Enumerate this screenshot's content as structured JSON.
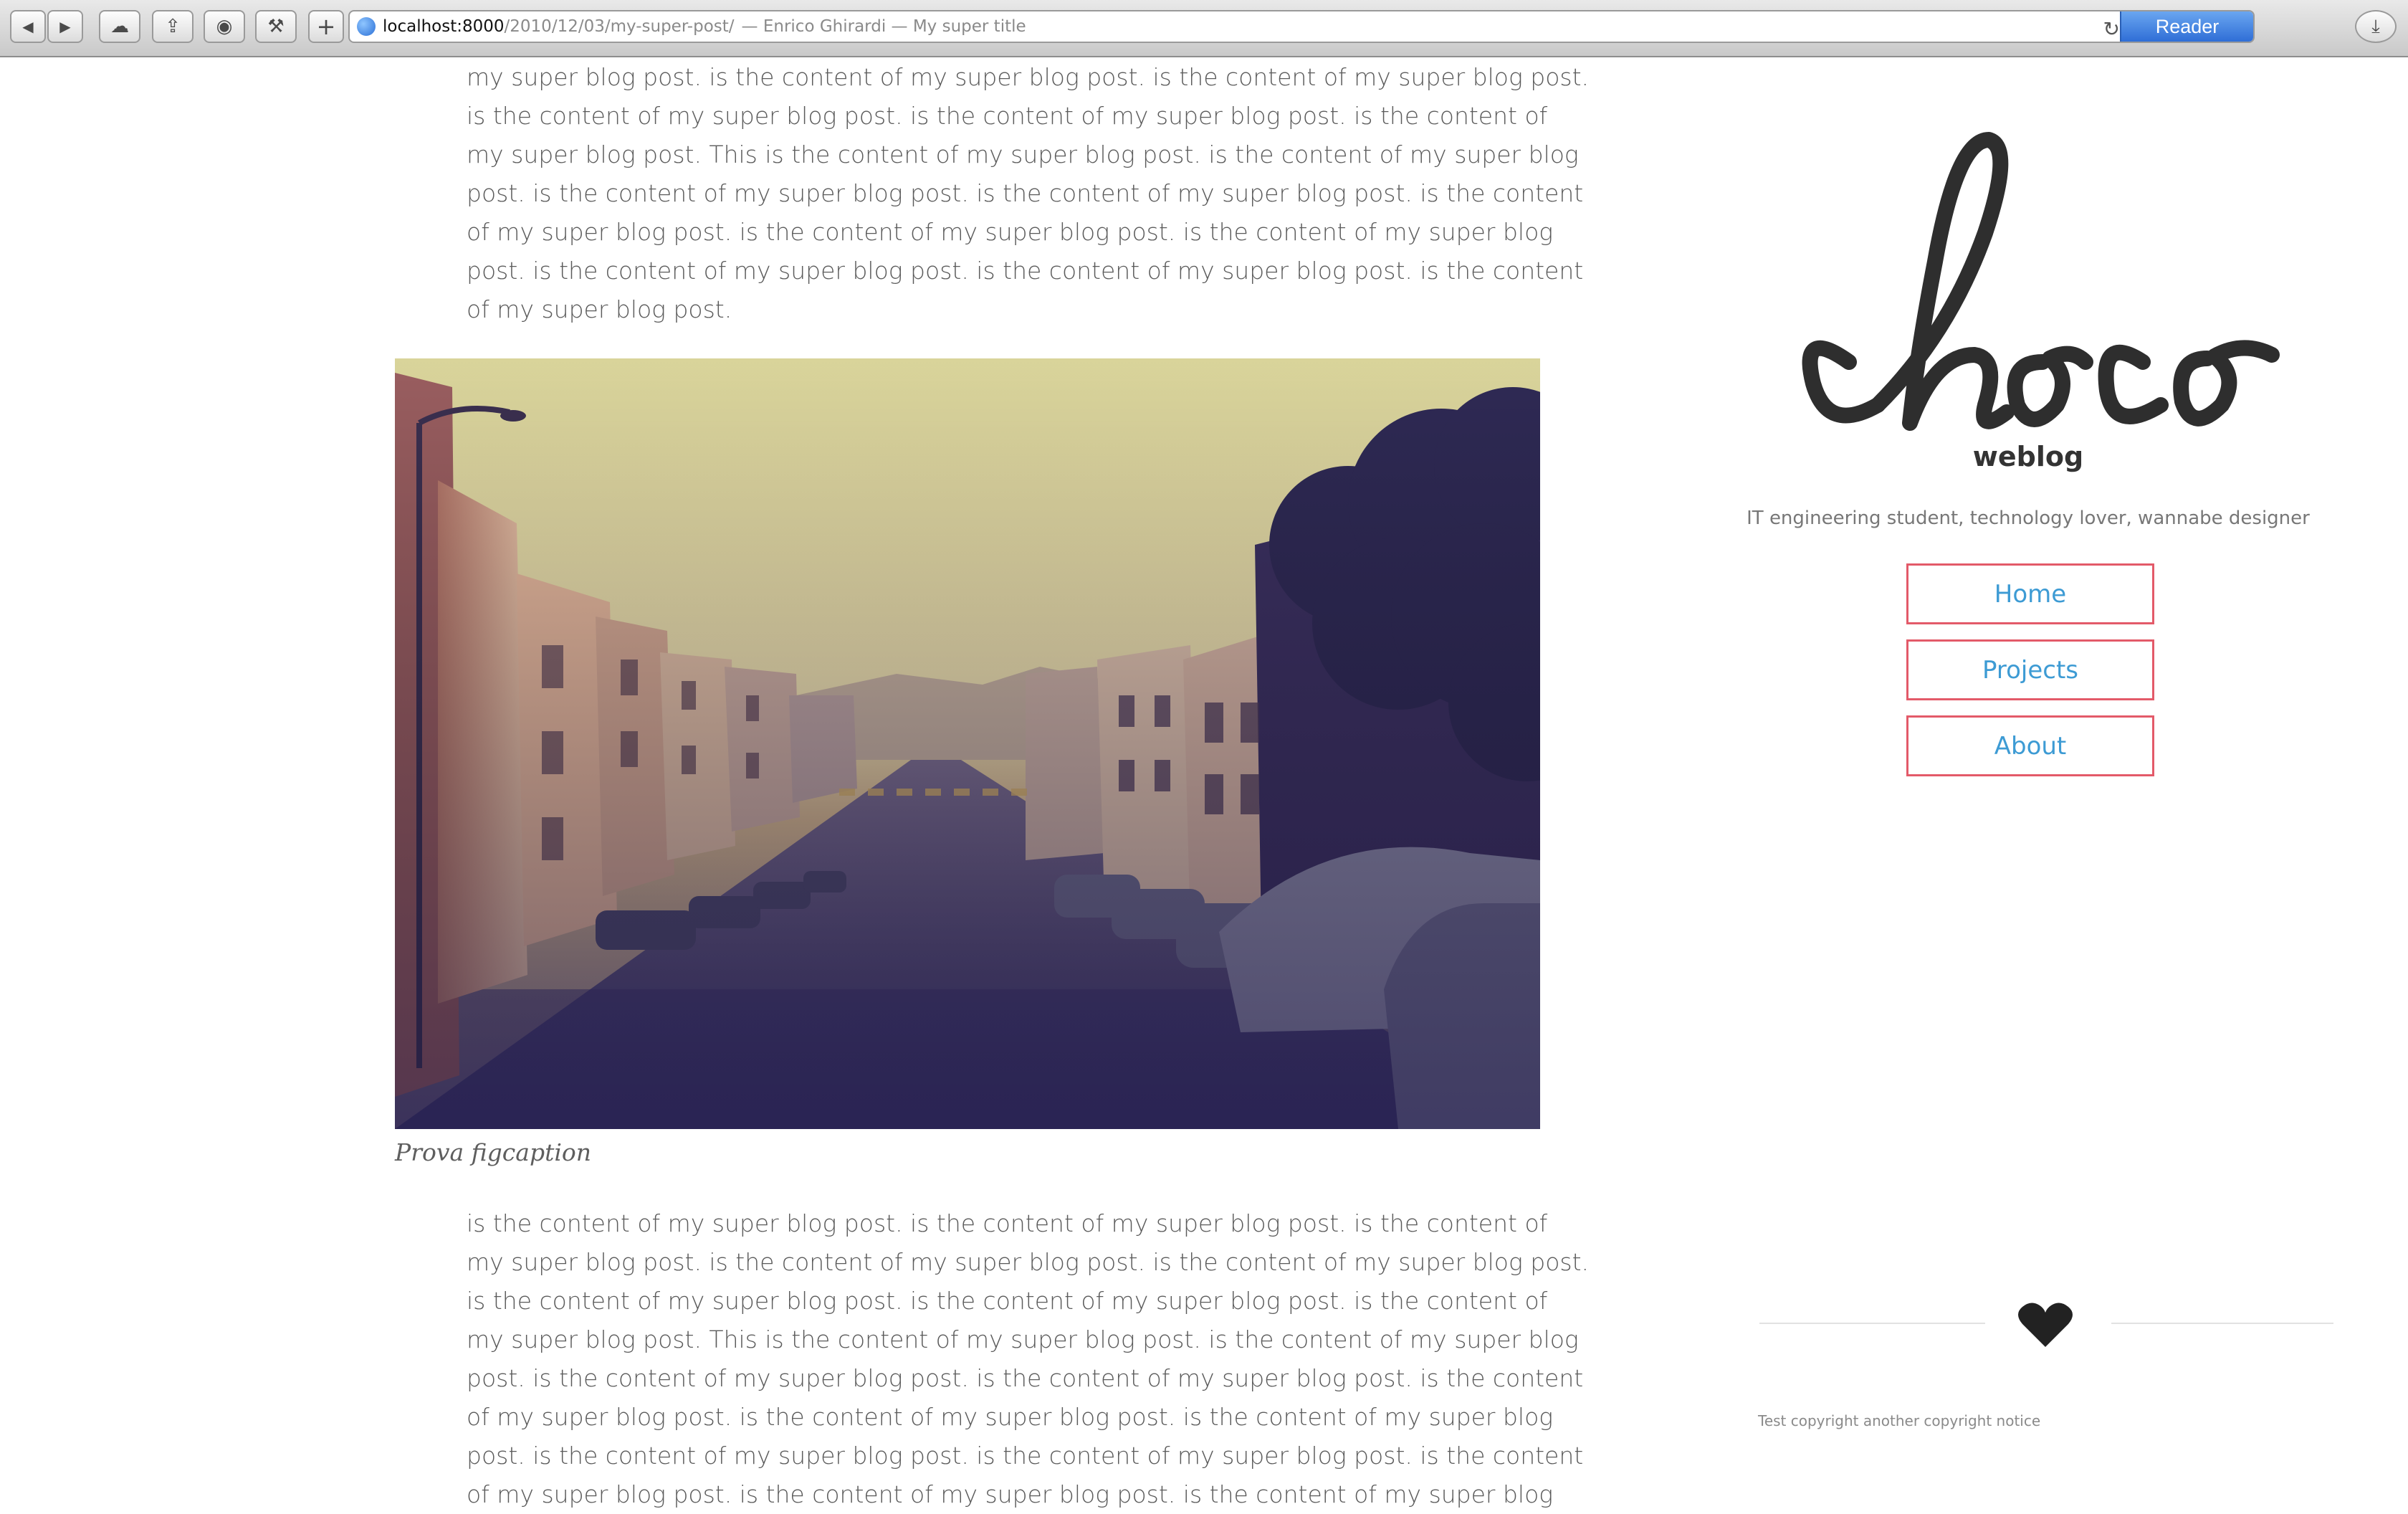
{
  "browser": {
    "url_host": "localhost:8000",
    "url_path": "/2010/12/03/my-super-post/",
    "page_title": "— Enrico Ghirardi — My super title",
    "reader_label": "Reader",
    "buttons": [
      {
        "name": "back-icon",
        "glyph": "◀"
      },
      {
        "name": "forward-icon",
        "glyph": "▶"
      },
      {
        "name": "icloud-icon",
        "glyph": "☁"
      },
      {
        "name": "share-icon",
        "glyph": "⇪"
      },
      {
        "name": "privacy-icon",
        "glyph": "◉"
      },
      {
        "name": "tools-icon",
        "glyph": "⚒"
      },
      {
        "name": "add-tab-icon",
        "glyph": "+"
      }
    ],
    "reload_glyph": "↻",
    "download_glyph": "⤓"
  },
  "article": {
    "top_lines": [
      "my super blog post. is the content of my super blog post. is the content of my super blog post.",
      "is the content of my super blog post. is the content of my super blog post. is the content of",
      "my super blog post. This is the content of my super blog post. is the content of my super blog",
      "post. is the content of my super blog post. is the content of my super blog post. is the content",
      "of my super blog post. is the content of my super blog post. is the content of my super blog",
      "post. is the content of my super blog post. is the content of my super blog post. is the content",
      "of my super blog post."
    ],
    "figcaption": "Prova figcaption",
    "bottom_lines": [
      "is the content of my super blog post. is the content of my super blog post. is the content of",
      "my super blog post. is the content of my super blog post. is the content of my super blog post.",
      "is the content of my super blog post. is the content of my super blog post. is the content of",
      "my super blog post. This is the content of my super blog post. is the content of my super blog",
      "post. is the content of my super blog post. is the content of my super blog post. is the content",
      "of my super blog post. is the content of my super blog post. is the content of my super blog",
      "post. is the content of my super blog post. is the content of my super blog post. is the content",
      "of my super blog post. is the content of my super blog post. is the content of my super blog"
    ]
  },
  "sidebar": {
    "logo_text": "choco",
    "subtitle": "weblog",
    "tagline": "IT engineering student, technology lover, wannabe designer",
    "nav": [
      {
        "label": "Home"
      },
      {
        "label": "Projects"
      },
      {
        "label": "About"
      }
    ],
    "copyright": "Test copyright another copyright notice"
  },
  "colors": {
    "nav_border": "#e35a69",
    "nav_text": "#3d9bd4",
    "body_text": "#5b5b5b",
    "logo": "#2e2e2e"
  }
}
